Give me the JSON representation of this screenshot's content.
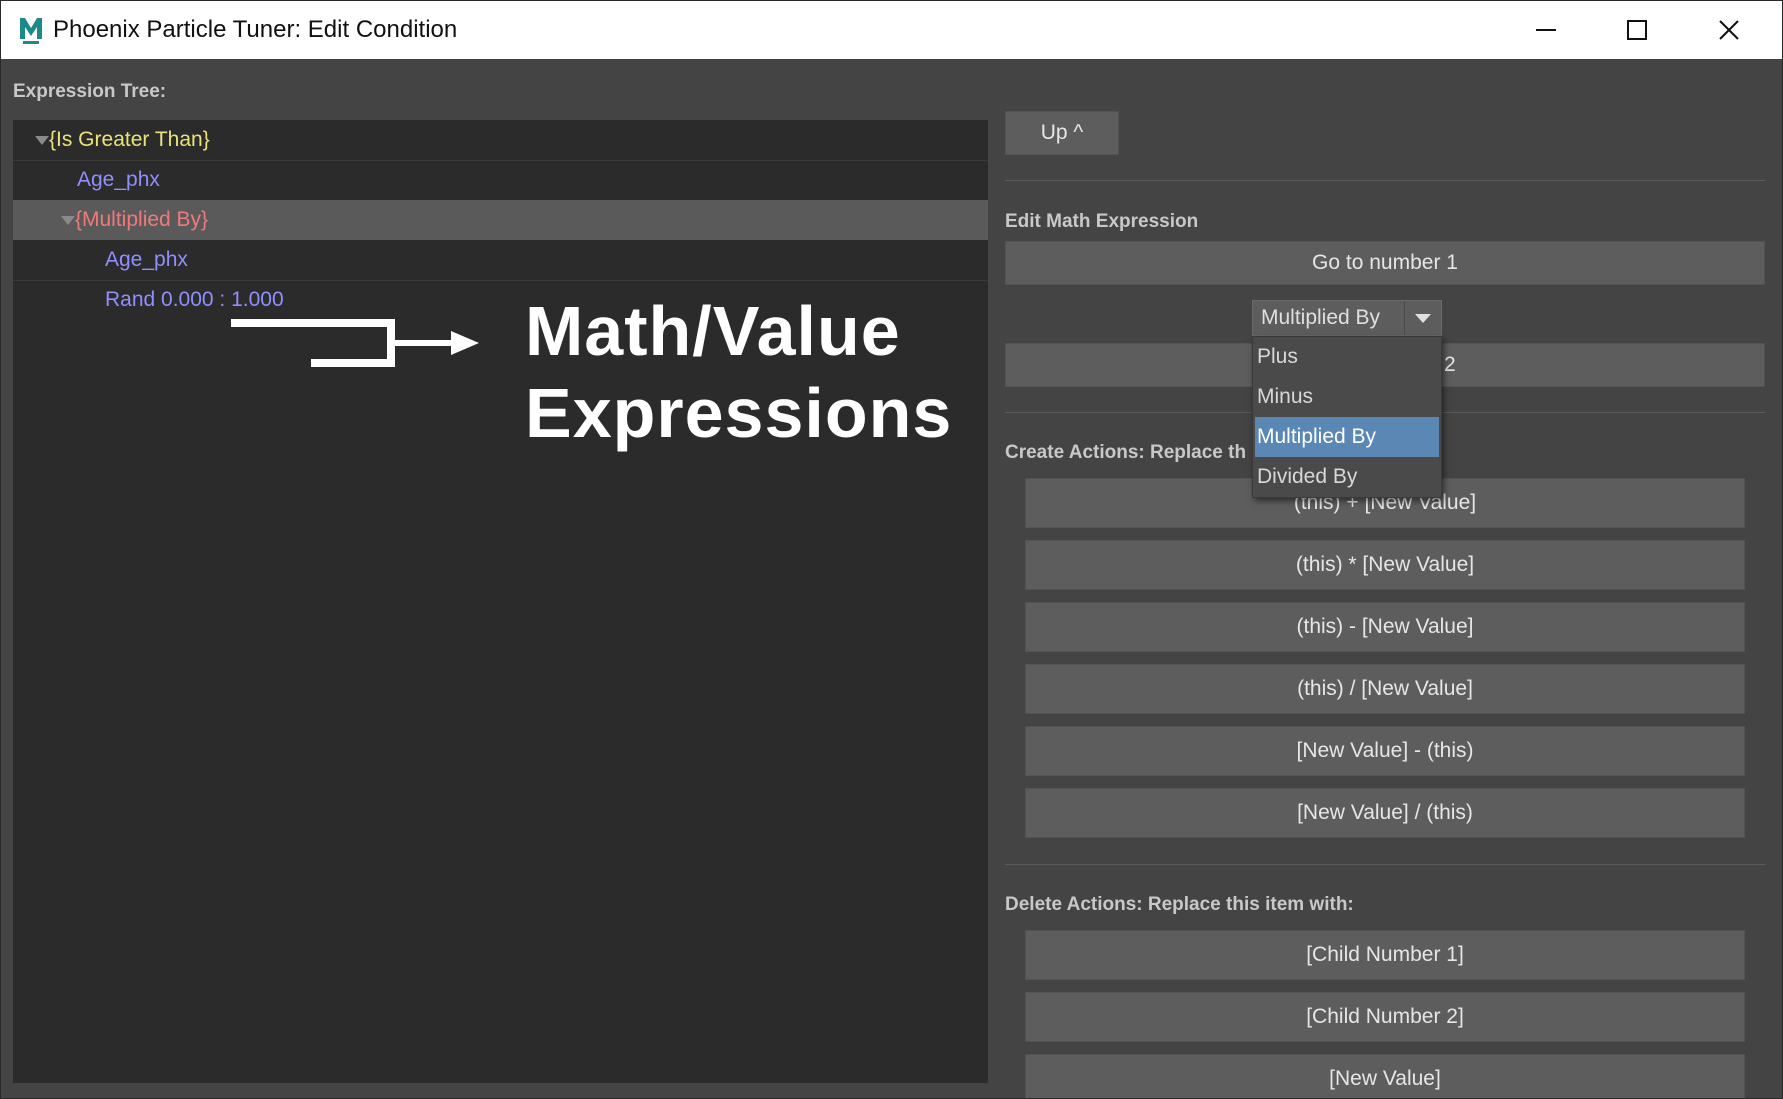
{
  "window": {
    "title": "Phoenix Particle Tuner: Edit Condition",
    "icon": "maya-logo-icon"
  },
  "tree": {
    "label": "Expression Tree:",
    "rows": [
      {
        "text": "{Is Greater Than}",
        "color": "#e9e37a",
        "expanded": true
      },
      {
        "text": "Age_phx",
        "color": "#8f8fff"
      },
      {
        "text": "{Multiplied By}",
        "color": "#f07a7a",
        "expanded": true,
        "selected": true
      },
      {
        "text": "Age_phx",
        "color": "#8f8fff"
      },
      {
        "text": "Rand 0.000 : 1.000",
        "color": "#8f8fff"
      }
    ]
  },
  "annotation": {
    "line1": "Math/Value",
    "line2": "Expressions"
  },
  "right": {
    "up_label": "Up ^",
    "edit_label": "Edit Math Expression",
    "goto1_label": "Go to number 1",
    "goto2_tail": "2",
    "operator": {
      "selected": "Multiplied By",
      "options": [
        "Plus",
        "Minus",
        "Multiplied By",
        "Divided By"
      ],
      "highlighted_index": 2
    },
    "create_label": "Create Actions: Replace th",
    "create_buttons": [
      "(this) + [New Value]",
      "(this) * [New Value]",
      "(this) - [New Value]",
      "(this) / [New Value]",
      "[New Value] - (this)",
      "[New Value] / (this)"
    ],
    "delete_label": "Delete Actions: Replace this item with:",
    "delete_buttons": [
      "[Child Number 1]",
      "[Child Number 2]",
      "[New Value]"
    ]
  },
  "colors": {
    "window_bg": "#444444",
    "tree_bg": "#2b2b2b",
    "button_bg": "#5d5d5d",
    "highlight": "#5a87b3"
  }
}
